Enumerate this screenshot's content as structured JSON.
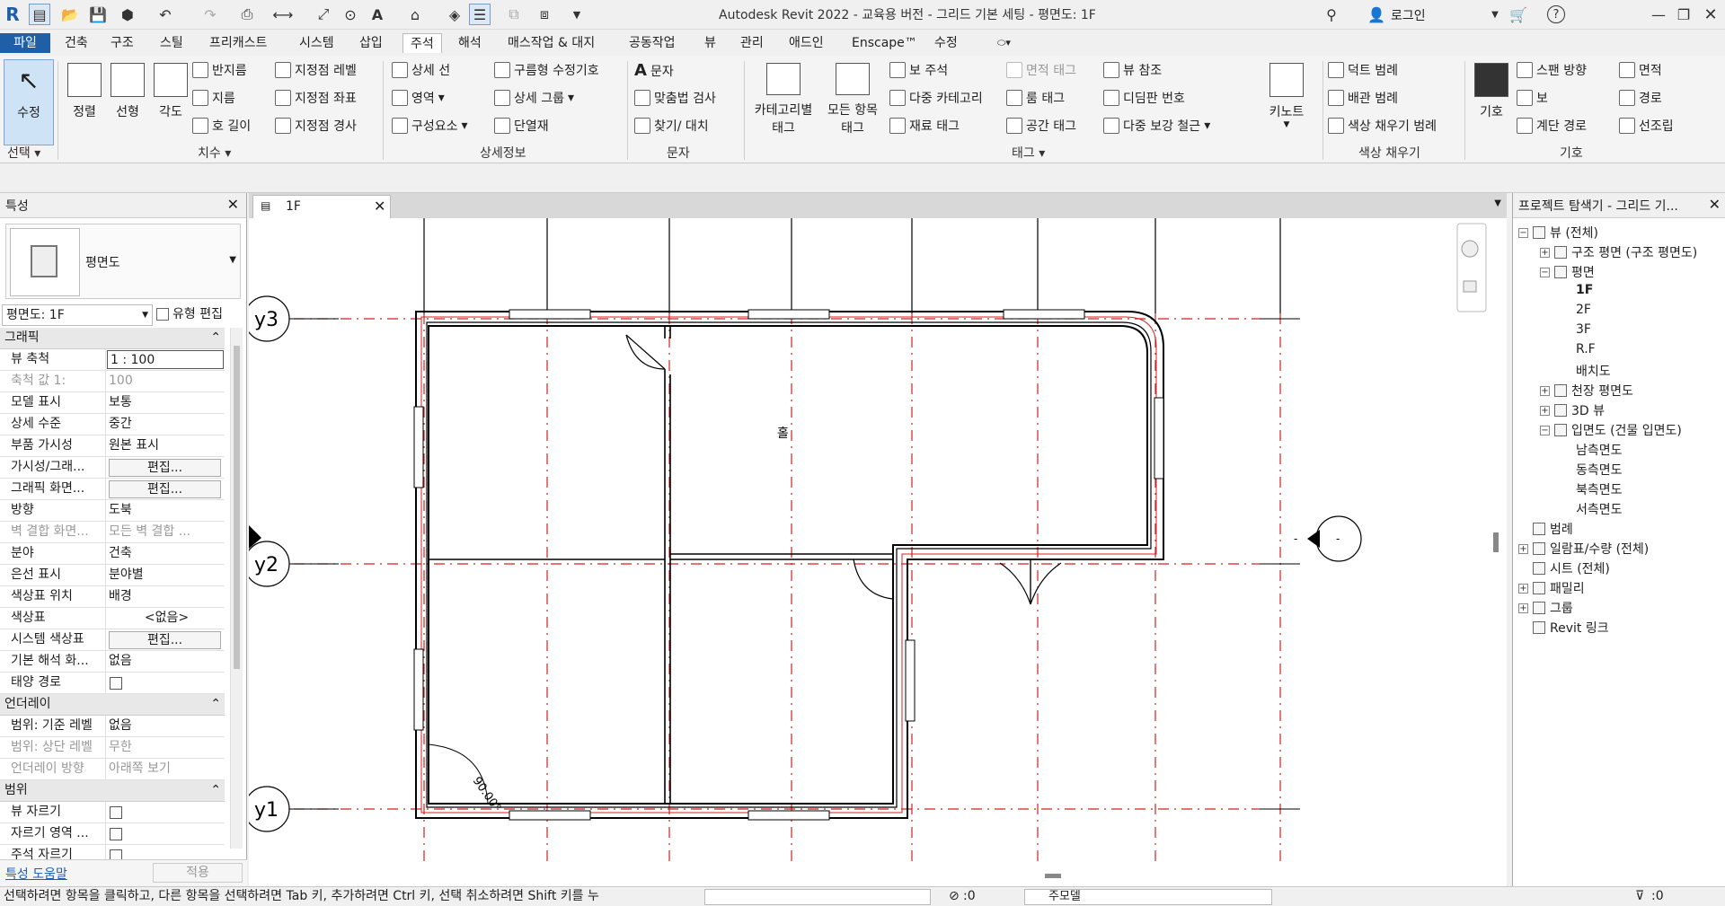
{
  "app": {
    "title": "Autodesk Revit 2022 - 교육용 버전 - 그리드 기본 세팅 - 평면도: 1F",
    "login": "로그인",
    "help": "?"
  },
  "tabs": [
    "파일",
    "건축",
    "구조",
    "스틸",
    "프리캐스트",
    "시스템",
    "삽입",
    "주석",
    "해석",
    "매스작업 & 대지",
    "공동작업",
    "뷰",
    "관리",
    "애드인",
    "Enscape™",
    "수정"
  ],
  "ribbon": {
    "select": {
      "modify": "수정",
      "panel": "선택"
    },
    "dimension": {
      "aligned": "정렬",
      "linear": "선형",
      "angular": "각도",
      "radius": "반지름",
      "diameter": "지름",
      "arc_length": "호 길이",
      "spot_elev": "지정점 레벨",
      "spot_coord": "지정점 좌표",
      "spot_slope": "지정점 경사",
      "panel": "치수"
    },
    "detail": {
      "detail_line": "상세 선",
      "region": "영역",
      "component": "구성요소",
      "revision_cloud": "구름형 수정기호",
      "detail_group": "상세 그룹",
      "insulation": "단열재",
      "panel": "상세정보"
    },
    "text": {
      "text": "문자",
      "spell": "맞춤법 검사",
      "find": "찾기/ 대치",
      "panel": "문자"
    },
    "tag": {
      "by_category_1": "카테고리별",
      "by_category_2": "태그",
      "all_1": "모든 항목",
      "all_2": "태그",
      "beam_ann": "보 주석",
      "multi_cat": "다중 카테고리",
      "material": "재료 태그",
      "area_tag": "면적 태그",
      "room_tag": "룸 태그",
      "space_tag": "공간 태그",
      "view_ref": "뷰 참조",
      "tread": "디딤판 번호",
      "multi_rebar": "다중 보강 철근",
      "keynote": "키노트",
      "panel": "태그"
    },
    "color_fill": {
      "duct": "덕트 범례",
      "pipe": "배관 범례",
      "color_legend": "색상 채우기 범례",
      "panel": "색상 채우기"
    },
    "symbol": {
      "symbol": "기호",
      "span": "스팬 방향",
      "beam": "보",
      "stair_path": "계단 경로",
      "area": "면적",
      "path": "경로",
      "assembly": "선조립",
      "panel": "기호"
    }
  },
  "properties": {
    "title": "특성",
    "type_name": "평면도",
    "instance_selector": "평면도: 1F",
    "edit_type": "유형 편집",
    "graphics_section": "그래픽",
    "rows": [
      {
        "k": "뷰 축척",
        "v": "1 : 100"
      },
      {
        "k": "축척 값    1:",
        "v": "100"
      },
      {
        "k": "모델 표시",
        "v": "보통"
      },
      {
        "k": "상세 수준",
        "v": "중간"
      },
      {
        "k": "부품 가시성",
        "v": "원본 표시"
      },
      {
        "k": "가시성/그래...",
        "v": "편집..."
      },
      {
        "k": "그래픽 화면...",
        "v": "편집..."
      },
      {
        "k": "방향",
        "v": "도북"
      },
      {
        "k": "벽 결합 화면...",
        "v": "모든 벽 결합 ..."
      },
      {
        "k": "분야",
        "v": "건축"
      },
      {
        "k": "은선 표시",
        "v": "분야별"
      },
      {
        "k": "색상표 위치",
        "v": "배경"
      },
      {
        "k": "색상표",
        "v": "<없음>"
      },
      {
        "k": "시스템 색상표",
        "v": "편집..."
      },
      {
        "k": "기본 해석 화...",
        "v": "없음"
      },
      {
        "k": "태양 경로",
        "v": ""
      }
    ],
    "underlay_section": "언더레이",
    "underlay_rows": [
      {
        "k": "범위: 기준 레벨",
        "v": "없음"
      },
      {
        "k": "범위: 상단 레벨",
        "v": "무한"
      },
      {
        "k": "언더레이 방향",
        "v": "아래쪽 보기"
      }
    ],
    "extents_section": "범위",
    "extents_rows": [
      {
        "k": "뷰 자르기",
        "v": ""
      },
      {
        "k": "자르기 영역 ...",
        "v": ""
      },
      {
        "k": "주석 자르기",
        "v": ""
      }
    ],
    "help_link": "특성 도움말",
    "apply": "적용"
  },
  "view": {
    "tab_label": "1F",
    "room_label": "홀",
    "angle_label": "90.00°",
    "grids": [
      "y3",
      "y2",
      "y1"
    ],
    "elevation_marker": "-"
  },
  "browser": {
    "title": "프로젝트 탐색기 - 그리드 기...",
    "items": [
      {
        "label": "뷰 (전체)",
        "level": 0,
        "exp": "-"
      },
      {
        "label": "구조 평면 (구조 평면도)",
        "level": 1,
        "exp": "+"
      },
      {
        "label": "평면",
        "level": 1,
        "exp": "-"
      },
      {
        "label": "1F",
        "level": 2,
        "exp": "",
        "bold": true
      },
      {
        "label": "2F",
        "level": 2,
        "exp": ""
      },
      {
        "label": "3F",
        "level": 2,
        "exp": ""
      },
      {
        "label": "R.F",
        "level": 2,
        "exp": ""
      },
      {
        "label": "배치도",
        "level": 2,
        "exp": ""
      },
      {
        "label": "천장 평면도",
        "level": 1,
        "exp": "+"
      },
      {
        "label": "3D 뷰",
        "level": 1,
        "exp": "+"
      },
      {
        "label": "입면도 (건물 입면도)",
        "level": 1,
        "exp": "-"
      },
      {
        "label": "남측면도",
        "level": 2,
        "exp": ""
      },
      {
        "label": "동측면도",
        "level": 2,
        "exp": ""
      },
      {
        "label": "북측면도",
        "level": 2,
        "exp": ""
      },
      {
        "label": "서측면도",
        "level": 2,
        "exp": ""
      },
      {
        "label": "범례",
        "level": 0,
        "exp": ""
      },
      {
        "label": "일람표/수량 (전체)",
        "level": 0,
        "exp": "+"
      },
      {
        "label": "시트 (전체)",
        "level": 0,
        "exp": ""
      },
      {
        "label": "패밀리",
        "level": 0,
        "exp": "+"
      },
      {
        "label": "그룹",
        "level": 0,
        "exp": "+"
      },
      {
        "label": "Revit 링크",
        "level": 0,
        "exp": ""
      }
    ]
  },
  "status": {
    "message": "선택하려면 항목을 클릭하고, 다른 항목을 선택하려면 Tab 키, 추가하려면 Ctrl 키, 선택 취소하려면 Shift 키를 누",
    "zero": ":0",
    "model": "주모델"
  }
}
